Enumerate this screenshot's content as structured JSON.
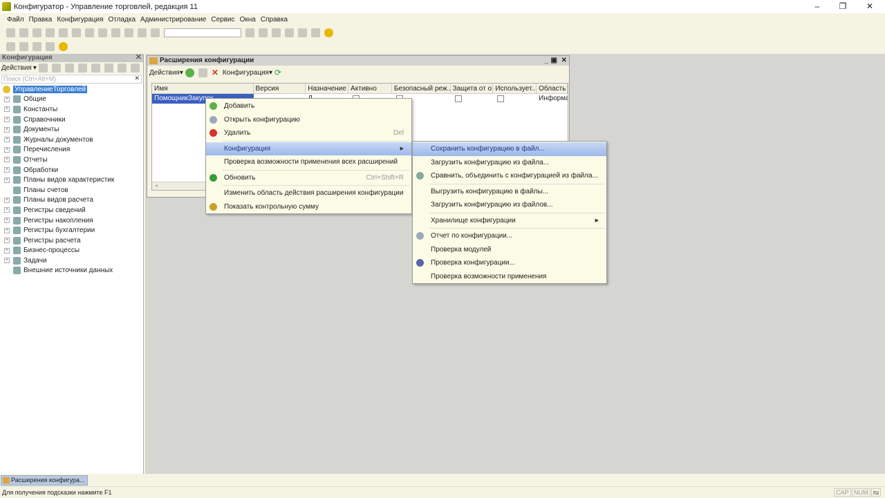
{
  "window": {
    "title": "Конфигуратор - Управление торговлей, редакция 11",
    "minimize": "–",
    "maximize": "❐",
    "close": "✕"
  },
  "menubar": [
    "Файл",
    "Правка",
    "Конфигурация",
    "Отладка",
    "Администрирование",
    "Сервис",
    "Окна",
    "Справка"
  ],
  "left_panel": {
    "title": "Конфигурация",
    "actions": "Действия",
    "search_placeholder": "Поиск (Ctrl+Alt+M)",
    "tree": [
      {
        "label": "УправлениеТорговлей",
        "root": true
      },
      {
        "label": "Общие"
      },
      {
        "label": "Константы"
      },
      {
        "label": "Справочники"
      },
      {
        "label": "Документы"
      },
      {
        "label": "Журналы документов"
      },
      {
        "label": "Перечисления"
      },
      {
        "label": "Отчеты"
      },
      {
        "label": "Обработки"
      },
      {
        "label": "Планы видов характеристик"
      },
      {
        "label": "Планы счетов"
      },
      {
        "label": "Планы видов расчета"
      },
      {
        "label": "Регистры сведений"
      },
      {
        "label": "Регистры накопления"
      },
      {
        "label": "Регистры бухгалтерии"
      },
      {
        "label": "Регистры расчета"
      },
      {
        "label": "Бизнес-процессы"
      },
      {
        "label": "Задачи"
      },
      {
        "label": "Внешние источники данных"
      }
    ]
  },
  "ext_window": {
    "title": "Расширения конфигурации",
    "actions": "Действия",
    "config_menu": "Конфигурация",
    "columns": [
      "Имя",
      "Версия",
      "Назначение",
      "Активно",
      "Безопасный реж...",
      "Защита от о...",
      "Использует...",
      "Область"
    ],
    "rows": [
      {
        "name": "ПомощникЗакупок",
        "version": "",
        "purpose": "Д...",
        "active": true,
        "safe": false,
        "protect": false,
        "uses": false,
        "scope": "Информа"
      }
    ]
  },
  "context_menu": [
    {
      "label": "Добавить",
      "icon": "add-icon",
      "color": "#5bb04a"
    },
    {
      "label": "Открыть конфигурацию",
      "icon": "open-config-icon",
      "color": "#9ab"
    },
    {
      "label": "Удалить",
      "shortcut": "Del",
      "icon": "delete-icon",
      "color": "#d9302a"
    },
    {
      "label": "Конфигурация",
      "submenu": true,
      "selected": true
    },
    {
      "label": "Проверка возможности применения всех расширений"
    },
    {
      "label": "Обновить",
      "shortcut": "Ctrl+Shift+R",
      "icon": "refresh-icon",
      "color": "#3a9a3a"
    },
    {
      "label": "Изменить область действия расширения конфигурации"
    },
    {
      "label": "Показать контрольную сумму",
      "icon": "checksum-icon",
      "color": "#c9a030"
    }
  ],
  "submenu": [
    {
      "label": "Сохранить конфигурацию в файл...",
      "selected": true
    },
    {
      "label": "Загрузить конфигурацию из файла..."
    },
    {
      "label": "Сравнить, объединить с конфигурацией из файла...",
      "icon": "compare-icon",
      "color": "#8a9"
    },
    {
      "label": "Выгрузить конфигурацию в файлы..."
    },
    {
      "label": "Загрузить конфигурацию из файлов..."
    },
    {
      "label": "Хранилище конфигурации",
      "submenu": true
    },
    {
      "label": "Отчет по конфигурации...",
      "icon": "report-icon",
      "color": "#9ab"
    },
    {
      "label": "Проверка модулей"
    },
    {
      "label": "Проверка конфигурации...",
      "icon": "check-icon",
      "color": "#56a"
    },
    {
      "label": "Проверка возможности применения"
    }
  ],
  "taskbar": {
    "item": "Расширения конфигура..."
  },
  "status": {
    "hint": "Для получения подсказки нажмите F1",
    "cap": "CAP",
    "num": "NUM",
    "lang": "ru"
  }
}
